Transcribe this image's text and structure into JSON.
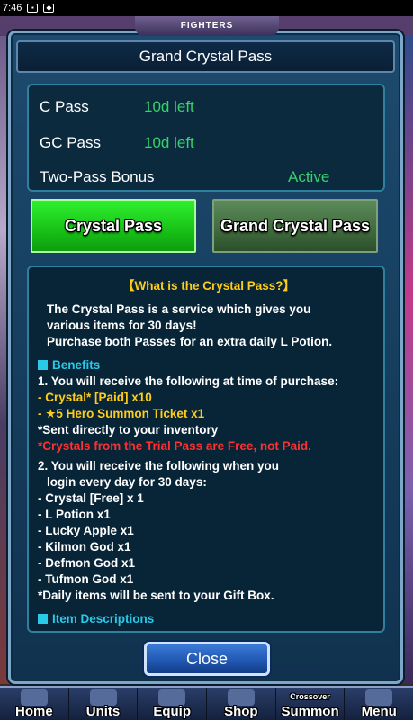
{
  "status_bar": {
    "time": "7:46"
  },
  "top_logo": {
    "text": "FIGHTERS"
  },
  "modal": {
    "title": "Grand Crystal Pass",
    "info": {
      "rows": [
        {
          "label": "C Pass",
          "value": "10d left"
        },
        {
          "label": "GC Pass",
          "value": "10d left"
        },
        {
          "label": "Two-Pass Bonus",
          "value": "Active"
        }
      ]
    },
    "tabs": {
      "crystal_pass": "Crystal Pass",
      "grand_crystal_pass": "Grand Crystal Pass"
    },
    "description": {
      "heading": "【What is the Crystal Pass?】",
      "intro": [
        "The Crystal Pass is a service which gives you",
        "various items for 30 days!",
        "Purchase both Passes for an extra daily L Potion."
      ],
      "benefits_heading": "Benefits",
      "purchase_heading": "1. You will receive the following at time of purchase:",
      "purchase_items": [
        "- Crystal* [Paid] x10",
        "- ★5 Hero Summon Ticket x1"
      ],
      "purchase_note": "*Sent directly to your inventory",
      "trial_note": "*Crystals from the Trial Pass are Free, not Paid.",
      "daily_heading_1": "2. You will receive the following when you",
      "daily_heading_2": "login every day for 30 days:",
      "daily_items": [
        "- Crystal [Free] x 1",
        "- L Potion x1",
        "- Lucky Apple x1",
        "- Kilmon God x1",
        "- Defmon God x1",
        "- Tufmon God x1"
      ],
      "daily_note": "*Daily items will be sent to your Gift Box.",
      "next_heading": "Item Descriptions"
    },
    "close_label": "Close"
  },
  "bottom_nav": {
    "items": [
      "Home",
      "Units",
      "Equip",
      "Shop",
      "Summon",
      "Menu"
    ],
    "summon_sub": "Crossover"
  }
}
